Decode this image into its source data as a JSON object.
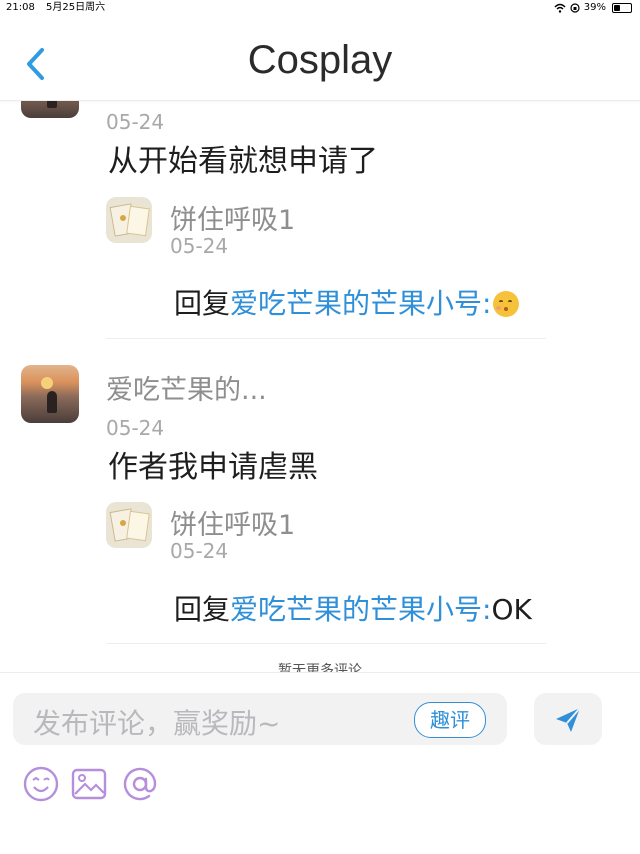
{
  "status_bar": {
    "time": "21:08",
    "date": "5月25日周六",
    "battery": "39%",
    "battery_level": 0.39
  },
  "header": {
    "title": "Cosplay",
    "back_icon": "chevron-left-icon"
  },
  "comments": [
    {
      "date": "05-24",
      "content": "从开始看就想申请了",
      "reply": {
        "name": "饼住呼吸1",
        "date": "05-24",
        "prefix": "回复",
        "mention": "爱吃芒果的芒果小号",
        "separator": ":",
        "text": "",
        "emoji": "kissing-face-emoji"
      }
    },
    {
      "name": "爱吃芒果的...",
      "date": "05-24",
      "content": "作者我申请虐黑",
      "reply": {
        "name": "饼住呼吸1",
        "date": "05-24",
        "prefix": "回复",
        "mention": "爱吃芒果的芒果小号",
        "separator": ":",
        "text": "OK"
      }
    }
  ],
  "no_more_text": "暂无更多评论",
  "input": {
    "placeholder": "发布评论，赢奖励~",
    "fun_comment_label": "趣评",
    "send_icon": "send-icon",
    "tools": [
      "emoji-icon",
      "image-icon",
      "mention-icon"
    ]
  },
  "colors": {
    "accent": "#2f8fd8",
    "tool_icon": "#b58fdc"
  }
}
